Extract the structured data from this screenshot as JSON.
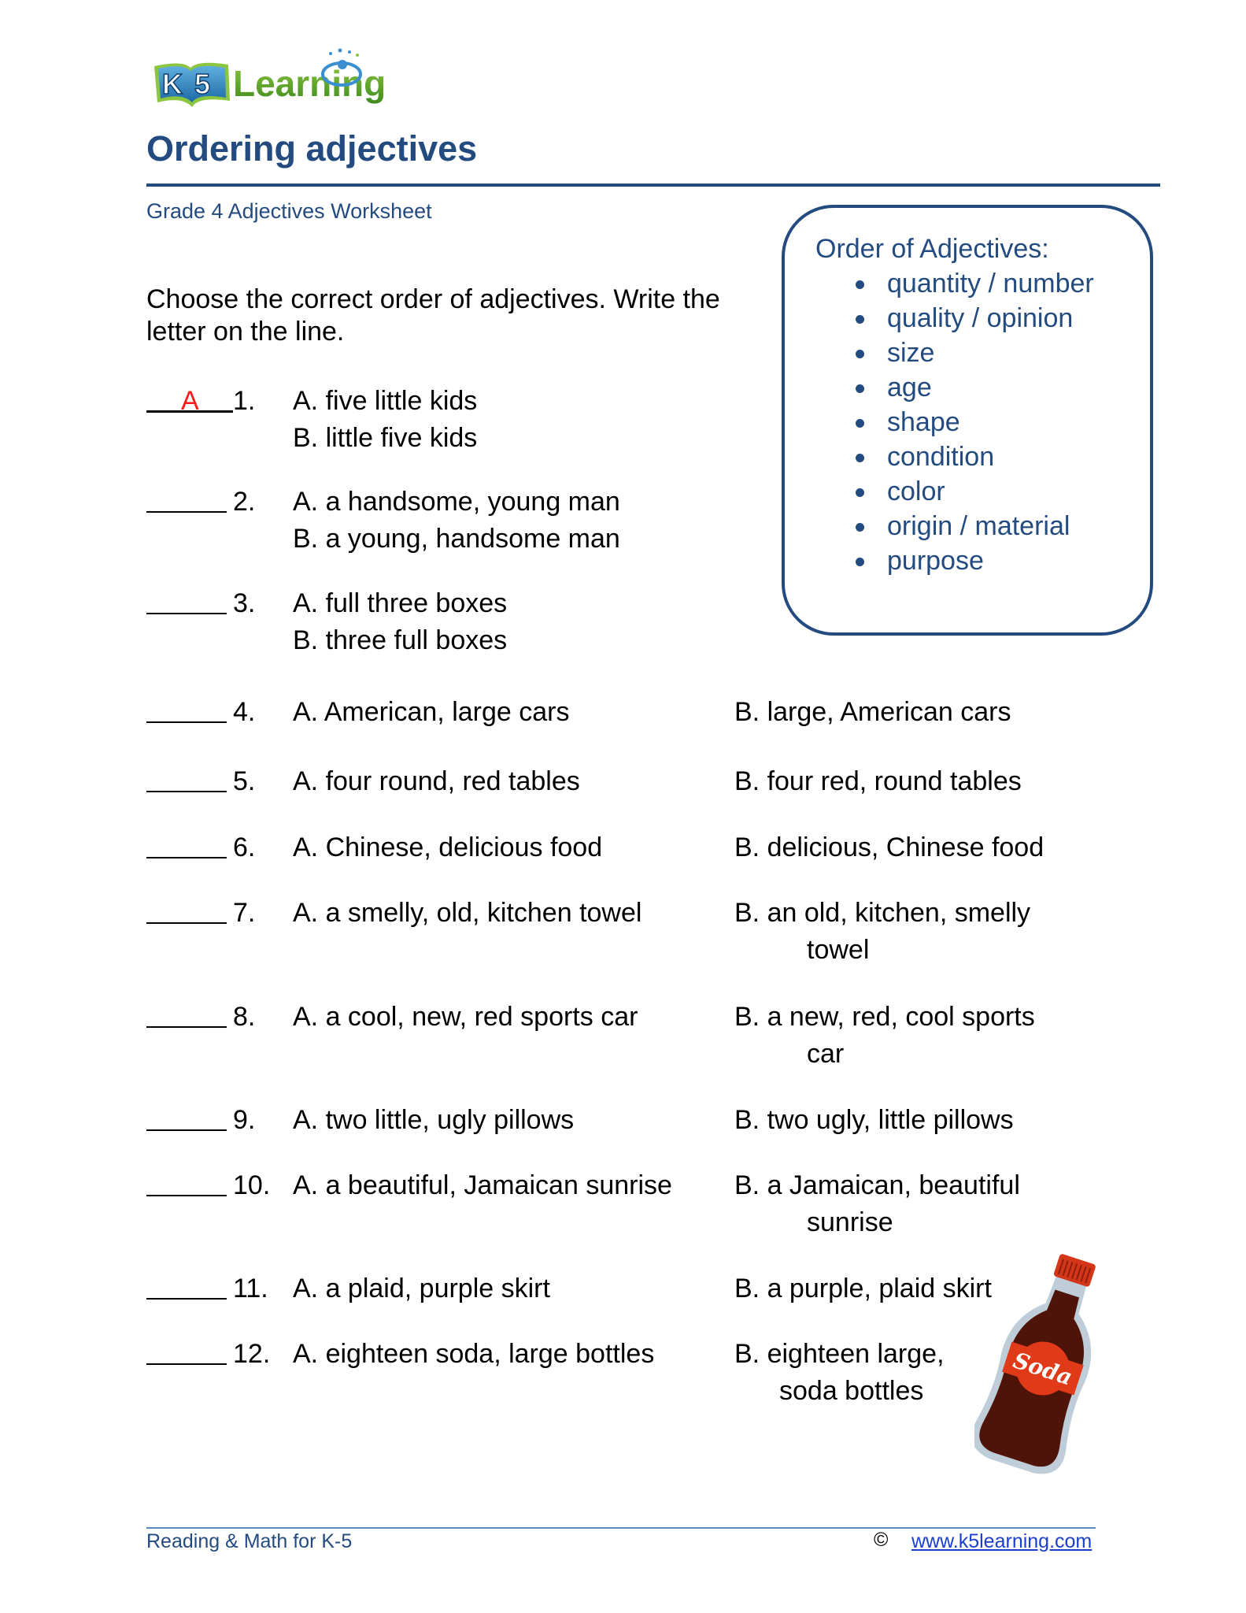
{
  "header": {
    "logo_text": "K5 Learning",
    "title": "Ordering adjectives",
    "subtitle": "Grade 4 Adjectives Worksheet"
  },
  "order_box": {
    "heading": "Order of Adjectives:",
    "items": [
      "quantity / number",
      "quality / opinion",
      "size",
      "age",
      "shape",
      "condition",
      "color",
      "origin / material",
      "purpose"
    ]
  },
  "instructions": "Choose the correct order of adjectives. Write the letter on the line.",
  "questions": [
    {
      "number": "1.",
      "answer": "A",
      "option_a": "A. five little kids",
      "option_b": "B. little five kids"
    },
    {
      "number": "2.",
      "answer": "",
      "option_a": "A. a handsome, young man",
      "option_b": "B. a young, handsome man"
    },
    {
      "number": "3.",
      "answer": "",
      "option_a": "A. full three boxes",
      "option_b": "B. three full boxes"
    },
    {
      "number": "4.",
      "answer": "",
      "option_a": "A. American, large cars",
      "option_b": "B. large, American cars"
    },
    {
      "number": "5.",
      "answer": "",
      "option_a": "A. four round, red tables",
      "option_b": "B. four red, round tables"
    },
    {
      "number": "6.",
      "answer": "",
      "option_a": "A. Chinese, delicious food",
      "option_b": "B. delicious, Chinese food"
    },
    {
      "number": "7.",
      "answer": "",
      "option_a": "A. a smelly, old, kitchen towel",
      "option_b": "B. an old, kitchen, smelly",
      "option_b_cont": "towel"
    },
    {
      "number": "8.",
      "answer": "",
      "option_a": "A. a cool, new, red sports car",
      "option_b": "B. a new, red, cool sports",
      "option_b_cont": "car"
    },
    {
      "number": "9.",
      "answer": "",
      "option_a": "A. two little, ugly pillows",
      "option_b": "B. two ugly, little pillows"
    },
    {
      "number": "10.",
      "answer": "",
      "option_a": "A. a beautiful, Jamaican sunrise",
      "option_b": "B. a Jamaican, beautiful",
      "option_b_cont": "sunrise"
    },
    {
      "number": "11.",
      "answer": "",
      "option_a": "A. a plaid, purple skirt",
      "option_b": "B. a purple, plaid skirt"
    },
    {
      "number": "12.",
      "answer": "",
      "option_a": "A. eighteen soda, large bottles",
      "option_b": "B. eighteen large,",
      "option_b_cont": "soda bottles"
    }
  ],
  "illustration": {
    "label": "Soda"
  },
  "footer": {
    "left": "Reading & Math for K-5",
    "copyright": "©",
    "link": "www.k5learning.com"
  },
  "colors": {
    "brand_navy": "#234b7f",
    "answer_red": "#ff1a1a",
    "link_blue": "#1a3fcc"
  }
}
